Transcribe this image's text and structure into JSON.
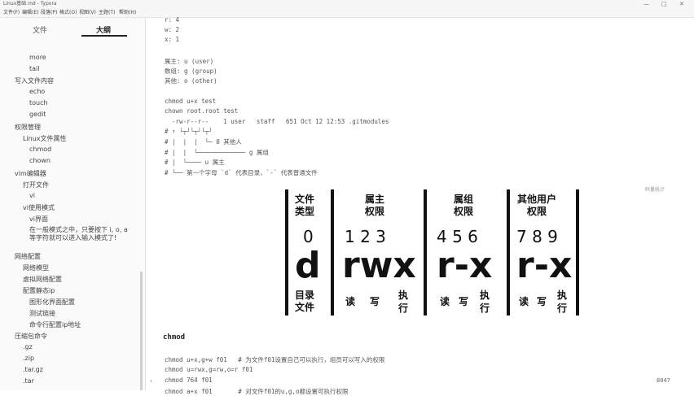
{
  "window": {
    "title": "Linux基础.md - Typora",
    "controls": [
      "—",
      "□",
      "✕"
    ]
  },
  "menu": [
    "文件(F)",
    "编辑(E)",
    "段落(P)",
    "格式(O)",
    "视图(V)",
    "主题(T)",
    "帮助(H)"
  ],
  "sidebar": {
    "tabs": [
      "文件",
      "大纲"
    ],
    "items": [
      {
        "label": "more"
      },
      {
        "label": "tail"
      },
      {
        "label": "写入文件内容"
      },
      {
        "label": "echo"
      },
      {
        "label": "touch"
      },
      {
        "label": "gedit"
      },
      {
        "label": "权限管理"
      },
      {
        "label": "Linux文件属性"
      },
      {
        "label": "chmod"
      },
      {
        "label": "chown"
      },
      {
        "label": "vim编辑器"
      },
      {
        "label": "打开文件"
      },
      {
        "label": "vi"
      },
      {
        "label": "vi使用模式"
      },
      {
        "label": "vi界面"
      },
      {
        "label": "在一般模式之中，只要按下 i, o, a 等字符就可以进入输入模式了!"
      },
      {
        "label": "网络配置"
      },
      {
        "label": "网络模型"
      },
      {
        "label": "虚拟网络配置"
      },
      {
        "label": "配置静态ip"
      },
      {
        "label": "图形化界面配置"
      },
      {
        "label": "测试链接"
      },
      {
        "label": "命令行配置ip地址"
      },
      {
        "label": "压缩包命令"
      },
      {
        "label": ".gz"
      },
      {
        "label": ".zip"
      },
      {
        "label": ".tar.gz"
      },
      {
        "label": ".tar"
      }
    ]
  },
  "editor": {
    "lines": [
      "r: 4",
      "w: 2",
      "x: 1",
      "属主: u (user)",
      "数组: g (group)",
      "其他: o (other)",
      "chmod u+x test",
      "chown root.root test",
      "  -rw-r--r--    1 user   staff   651 Oct 12 12:53 .gitmodules",
      "# ↑ └┬┘└┬┘└┬┘",
      "# |  |  |  └─ 0 其他人",
      "# |  |  └───────────── g 属组",
      "# |  └──── u 属主",
      "# └── 第一个字母 `d` 代表目录，`-` 代表普通文件",
      "chmod u+x,g+w f01   # 为文件f01设置自己可以执行，组员可以写入的权限",
      "chmod u=rwx,g=rw,o=r f01",
      "chmod 764 f01",
      "chmod a+x f01       # 对文件f01的u,g,o都设置可执行权限"
    ],
    "heading": "chmod",
    "search_hint": "码量统计",
    "word_count": "8047",
    "bottom_icon": "‹"
  },
  "permission_table": {
    "columns": [
      {
        "header": [
          "文件",
          "类型"
        ],
        "numbers": "0",
        "big": "d",
        "footer": [
          "目录",
          "文件"
        ]
      },
      {
        "header": [
          "属主",
          "权限"
        ],
        "numbers": "1 2 3",
        "big": "rwx",
        "footer": [
          "读",
          "写",
          "执",
          "行"
        ]
      },
      {
        "header": [
          "属组",
          "权限"
        ],
        "numbers": "4 5 6",
        "big": "r-x",
        "footer": [
          "读",
          "写",
          "执",
          "行"
        ]
      },
      {
        "header": [
          "其他用户",
          "权限"
        ],
        "numbers": "7 8 9",
        "big": "r-x",
        "footer": [
          "读",
          "写",
          "执",
          "行"
        ]
      }
    ]
  }
}
